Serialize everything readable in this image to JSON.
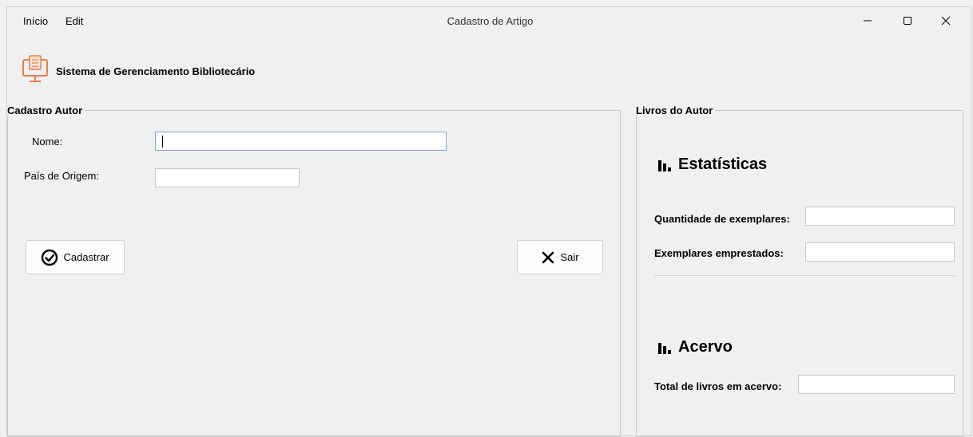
{
  "menu": {
    "inicio": "Início",
    "edit": "Edit"
  },
  "window": {
    "title": "Cadastro de Artigo"
  },
  "header": {
    "title": "Sistema de Gerenciamento Bibliotecário"
  },
  "cadastro": {
    "legend": "Cadastro Autor",
    "nome_label": "Nome:",
    "nome_value": "",
    "pais_label": "País de Origem:",
    "pais_value": "",
    "cadastrar_label": "Cadastrar",
    "sair_label": "Sair"
  },
  "livros": {
    "legend": "Livros do Autor",
    "estatisticas_title": "Estatísticas",
    "quantidade_label": "Quantidade de exemplares:",
    "quantidade_value": "",
    "emprestados_label": "Exemplares emprestados:",
    "emprestados_value": "",
    "acervo_title": "Acervo",
    "total_label": "Total de livros em acervo:",
    "total_value": ""
  },
  "colors": {
    "logo_accent": "#f07d4a",
    "focus_border": "#7aa6d6"
  }
}
